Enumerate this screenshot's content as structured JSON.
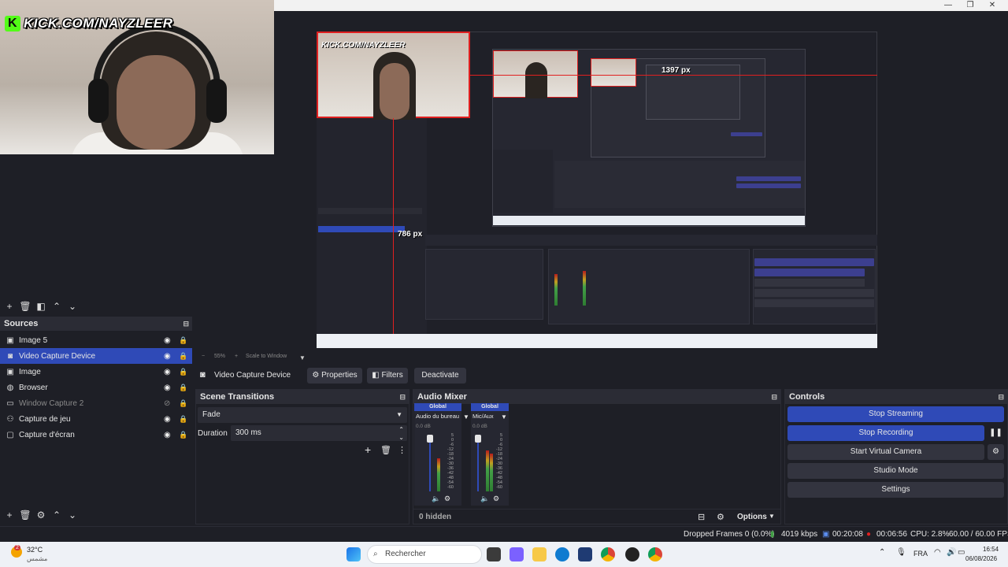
{
  "webcam": {
    "brand": "KICK.COM/NAYZLEER",
    "logo_letter": "K"
  },
  "preview": {
    "nested_brand": "KICK.COM/NAYZLEER",
    "measure_width": "1397 px",
    "measure_height": "786 px",
    "zoom": "55%",
    "zoom_mode": "Scale to Window"
  },
  "window": {
    "minimize_icon": "minimize-icon",
    "maximize_icon": "maximize-icon",
    "close_icon": "close-icon"
  },
  "sources": {
    "title": "Sources",
    "items": [
      {
        "label": "Image 5",
        "icon": "image-icon",
        "visible": true,
        "selected": false,
        "dim": false
      },
      {
        "label": "Video Capture Device",
        "icon": "camera-icon",
        "visible": true,
        "selected": true,
        "dim": false
      },
      {
        "label": "Image",
        "icon": "image-icon",
        "visible": true,
        "selected": false,
        "dim": false
      },
      {
        "label": "Browser",
        "icon": "globe-icon",
        "visible": true,
        "selected": false,
        "dim": false
      },
      {
        "label": "Window Capture 2",
        "icon": "window-icon",
        "visible": false,
        "selected": false,
        "dim": true
      },
      {
        "label": "Capture de jeu",
        "icon": "gamepad-icon",
        "visible": true,
        "selected": false,
        "dim": false
      },
      {
        "label": "Capture d'écran",
        "icon": "monitor-icon",
        "visible": true,
        "selected": false,
        "dim": false
      }
    ]
  },
  "propbar": {
    "source_name": "Video Capture Device",
    "properties": "Properties",
    "filters": "Filters",
    "deactivate": "Deactivate"
  },
  "transitions": {
    "title": "Scene Transitions",
    "selected": "Fade",
    "duration_label": "Duration",
    "duration_value": "300 ms"
  },
  "mixer": {
    "title": "Audio Mixer",
    "hidden": "0 hidden",
    "channels": [
      {
        "tag": "Global",
        "name": "Audio du bureau",
        "db": "0.0 dB",
        "level": 0.55
      },
      {
        "tag": "Global",
        "name": "Mic/Aux",
        "db": "0.0 dB",
        "level": 0.7
      }
    ],
    "scale": [
      "5",
      "0",
      "-6",
      "-12",
      "-18",
      "-24",
      "-30",
      "-36",
      "-42",
      "-48",
      "-54",
      "-60"
    ],
    "options": "Options"
  },
  "controls": {
    "title": "Controls",
    "stop_streaming": "Stop Streaming",
    "stop_recording": "Stop Recording",
    "start_virtual_camera": "Start Virtual Camera",
    "studio_mode": "Studio Mode",
    "settings": "Settings"
  },
  "status": {
    "dropped": "Dropped Frames 0 (0.0%)",
    "kbps": "4019 kbps",
    "stream_time": "00:20:08",
    "rec_time": "00:06:56",
    "cpu": "CPU: 2.8%",
    "fps": "60.00 / 60.00 FPS"
  },
  "taskbar": {
    "weather_temp": "32°C",
    "weather_desc": "مشمس",
    "weather_badge": "2",
    "search": "Rechercher",
    "lang": "FRA",
    "time": "16:54",
    "date": "06/08/2026"
  },
  "colors": {
    "accent": "#2f4ab7",
    "record": "#e02020",
    "brand_green": "#53fc18"
  }
}
